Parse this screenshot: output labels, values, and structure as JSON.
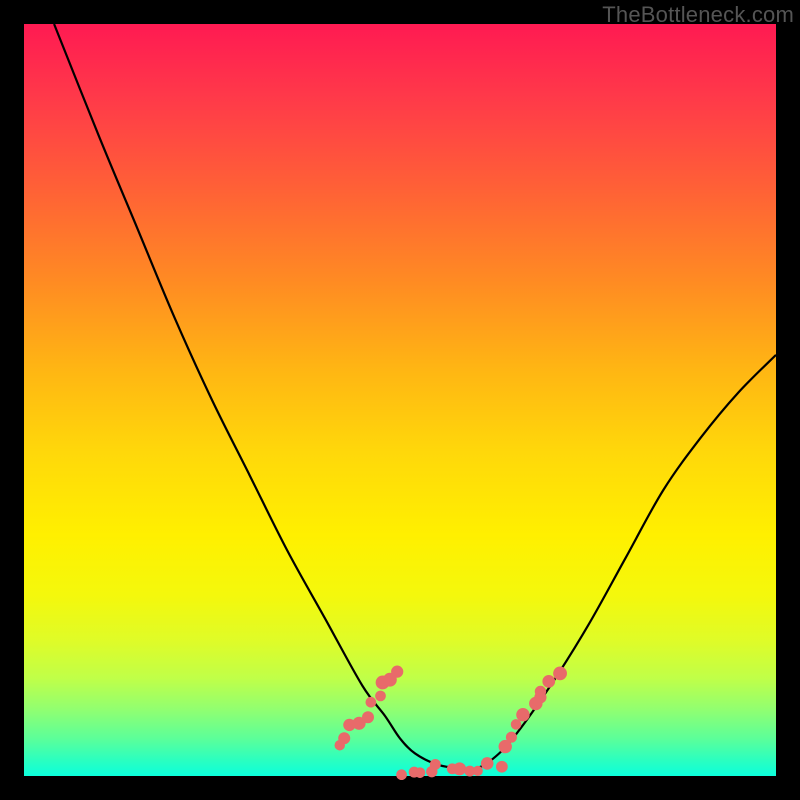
{
  "watermark": "TheBottleneck.com",
  "chart_data": {
    "type": "line",
    "title": "",
    "xlabel": "",
    "ylabel": "",
    "xlim": [
      0,
      100
    ],
    "ylim": [
      0,
      100
    ],
    "series": [
      {
        "name": "curve",
        "x": [
          4,
          10,
          15,
          20,
          25,
          30,
          35,
          40,
          45,
          48,
          50,
          52,
          55,
          58,
          60,
          62,
          65,
          70,
          75,
          80,
          85,
          90,
          95,
          100
        ],
        "y": [
          100,
          85,
          73,
          61,
          50,
          40,
          30,
          21,
          12,
          8,
          5,
          3,
          1.5,
          1,
          1,
          2,
          5,
          12,
          20,
          29,
          38,
          45,
          51,
          56
        ]
      }
    ],
    "highlight_band": {
      "y_from": 0,
      "y_to": 9,
      "note": "green optimal zone near bottom"
    },
    "dot_clusters": [
      {
        "name": "left-dots",
        "approx_x_range": [
          42,
          50
        ],
        "approx_y_range": [
          4,
          14
        ],
        "count": 10
      },
      {
        "name": "bottom-dots",
        "approx_x_range": [
          50,
          63
        ],
        "approx_y_range": [
          0.5,
          3
        ],
        "count": 11
      },
      {
        "name": "right-dots",
        "approx_x_range": [
          64,
          71
        ],
        "approx_y_range": [
          4,
          14
        ],
        "count": 9
      }
    ],
    "dot_color": "#e86a6a",
    "curve_color": "#000000"
  }
}
